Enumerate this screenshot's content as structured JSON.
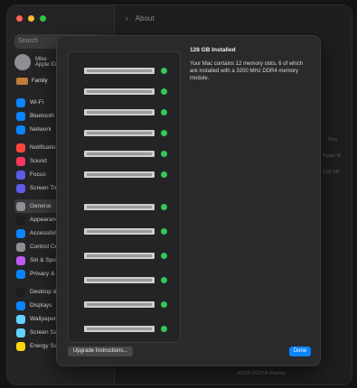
{
  "window": {
    "title": "About",
    "traffic_colors": [
      "#ff5f57",
      "#febc2e",
      "#28c840"
    ]
  },
  "sidebar": {
    "search_placeholder": "Search",
    "profile": {
      "name": "Mike",
      "sub": "Apple ID"
    },
    "family_label": "Family",
    "items": [
      {
        "label": "Wi-Fi",
        "color": "#0a84ff"
      },
      {
        "label": "Bluetooth",
        "color": "#0a84ff"
      },
      {
        "label": "Network",
        "color": "#0a84ff"
      },
      {
        "label": "Notifications",
        "color": "#ff453a"
      },
      {
        "label": "Sound",
        "color": "#ff375f"
      },
      {
        "label": "Focus",
        "color": "#5e5ce6"
      },
      {
        "label": "Screen Time",
        "color": "#5e5ce6"
      },
      {
        "label": "General",
        "color": "#8e8e93",
        "active": true
      },
      {
        "label": "Appearance",
        "color": "#1c1c1e"
      },
      {
        "label": "Accessibility",
        "color": "#0a84ff"
      },
      {
        "label": "Control Centre",
        "color": "#8e8e93"
      },
      {
        "label": "Siri & Spotlight",
        "color": "#bf5af2"
      },
      {
        "label": "Privacy & Security",
        "color": "#0a84ff"
      },
      {
        "label": "Desktop & Dock",
        "color": "#1c1c1e"
      },
      {
        "label": "Displays",
        "color": "#0a84ff"
      },
      {
        "label": "Wallpaper",
        "color": "#64d2ff"
      },
      {
        "label": "Screen Saver",
        "color": "#64d2ff"
      },
      {
        "label": "Energy Saver",
        "color": "#ffd60a"
      }
    ]
  },
  "background": {
    "right_label_1": "Flux",
    "right_label_2": "Apple M",
    "right_label_3": "128 GB",
    "display_row": "ASUS VG27A Display"
  },
  "memory_sheet": {
    "title": "128 GB Installed",
    "description": "Your Mac contains 12 memory slots, 6 of which are installed with a 3200 MHz DDR4 memory module.",
    "slot_count": 12,
    "slots_installed": [
      true,
      true,
      true,
      true,
      true,
      true,
      true,
      true,
      true,
      true,
      true,
      true
    ],
    "led_color": "#34c759",
    "buttons": {
      "instructions": "Upgrade Instructions...",
      "done": "Done"
    }
  }
}
